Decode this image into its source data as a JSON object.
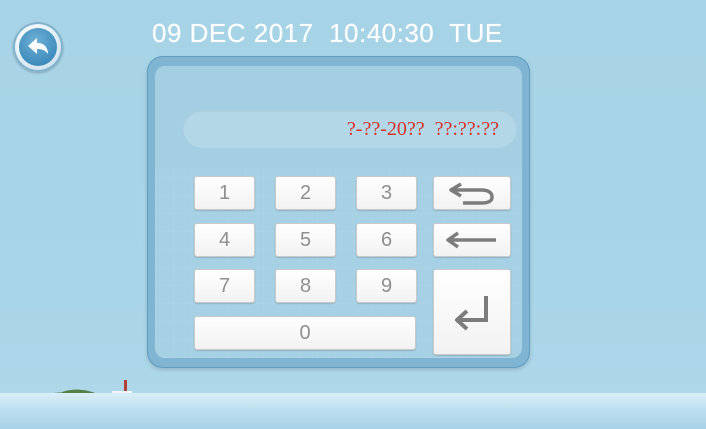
{
  "header": {
    "datetime": "09 DEC 2017  10:40:30  TUE"
  },
  "back_button": {
    "icon": "back-arrow-icon"
  },
  "display": {
    "value": "?-??-20??  ??:??:??",
    "color": "#d6322a"
  },
  "keypad": {
    "digits": [
      "1",
      "2",
      "3",
      "4",
      "5",
      "6",
      "7",
      "8",
      "9",
      "0"
    ],
    "controls": {
      "undo_icon": "undo-arrow-icon",
      "backspace_icon": "backspace-arrow-icon",
      "enter_icon": "enter-arrow-icon"
    }
  },
  "colors": {
    "background": "#a8d4e7",
    "panel": "#7fb5d3",
    "key": "#ffffff",
    "header_text": "#ffffff"
  }
}
